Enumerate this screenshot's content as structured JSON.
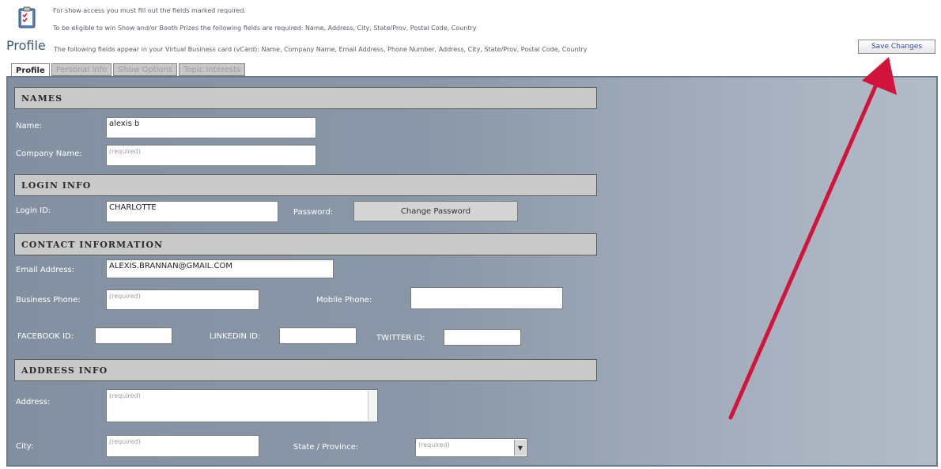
{
  "header": {
    "notes": [
      "For show access you must fill out the fields marked required.",
      "To be eligible to win Show and/or Booth Prizes the following fields are required: Name, Address, City, State/Prov, Postal Code, Country",
      "The following fields appear in your Virtual Business card (vCard): Name, Company Name, Email Address, Phone Number, Address, City, State/Prov, Postal Code, Country"
    ],
    "title": "Profile",
    "save_label": "Save Changes"
  },
  "tabs": [
    "Profile",
    "Personal Info",
    "Show Options",
    "Topic Interests"
  ],
  "sections": {
    "names": "NAMES",
    "login": "LOGIN INFO",
    "contact": "CONTACT INFORMATION",
    "address": "ADDRESS INFO"
  },
  "fields": {
    "name": {
      "label": "Name:",
      "value": "alexis b"
    },
    "company": {
      "label": "Company Name:",
      "placeholder": "(required)"
    },
    "login_id": {
      "label": "Login ID:",
      "value": "CHARLOTTE"
    },
    "password": {
      "label": "Password:",
      "button": "Change Password"
    },
    "email": {
      "label": "Email Address:",
      "value": "ALEXIS.BRANNAN@GMAIL.COM"
    },
    "business_phone": {
      "label": "Business Phone:",
      "placeholder": "(required)"
    },
    "mobile_phone": {
      "label": "Mobile Phone:",
      "value": ""
    },
    "facebook": {
      "label": "FACEBOOK ID:",
      "value": ""
    },
    "linkedin": {
      "label": "LINKEDIN ID:",
      "value": ""
    },
    "twitter": {
      "label": "TWITTER ID:",
      "value": ""
    },
    "address": {
      "label": "Address:",
      "placeholder": "(required)"
    },
    "city": {
      "label": "City:",
      "placeholder": "(required)"
    },
    "state": {
      "label": "State / Province:",
      "selected": "(required)"
    }
  },
  "colors": {
    "accent_arrow": "#d0143c",
    "panel": "#8a97a8",
    "section": "#c9c9c9"
  }
}
